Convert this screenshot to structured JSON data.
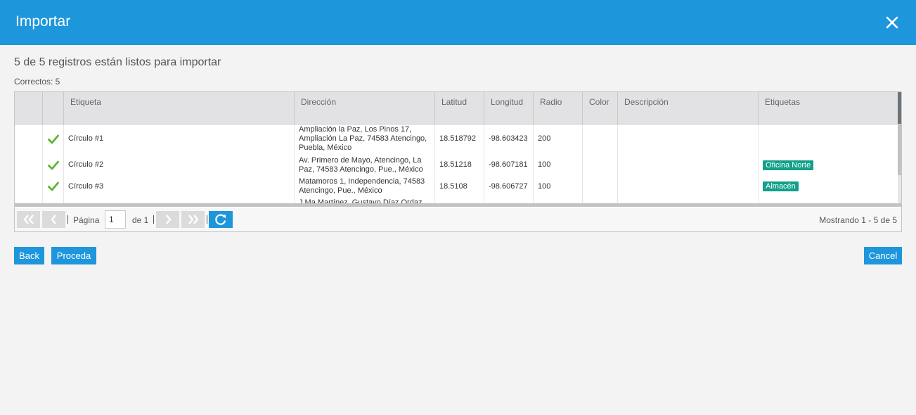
{
  "dialog": {
    "title": "Importar",
    "summary": "5 de 5 registros están listos para importar",
    "correct": "Correctos: 5"
  },
  "table": {
    "columns": [
      "Etiqueta",
      "Dirección",
      "Latitud",
      "Longitud",
      "Radio",
      "Color",
      "Descripción",
      "Etiquetas"
    ],
    "rows": [
      {
        "etiqueta": "Círculo #1",
        "direccion": "Ampliación la Paz, Los Pinos 17, Ampliación La Paz, 74583 Atencingo, Puebla, México",
        "latitud": "18.518792",
        "longitud": "-98.603423",
        "radio": "200",
        "color": "",
        "descripcion": "",
        "etiquetas": ""
      },
      {
        "etiqueta": "Círculo #2",
        "direccion": "Av. Primero de Mayo, Atencingo, La Paz, 74583 Atencingo, Pue., México",
        "latitud": "18.51218",
        "longitud": "-98.607181",
        "radio": "100",
        "color": "",
        "descripcion": "",
        "etiquetas": "Oficina Norte"
      },
      {
        "etiqueta": "Círculo #3",
        "direccion": "Matamoros 1, Independencia, 74583 Atencingo, Pue., México",
        "latitud": "18.5108",
        "longitud": "-98.606727",
        "radio": "100",
        "color": "",
        "descripcion": "",
        "etiquetas": "Almacén"
      },
      {
        "etiqueta": "",
        "direccion": "J Ma Martínez, Gustavo Díaz Ordaz",
        "latitud": "",
        "longitud": "",
        "radio": "",
        "color": "",
        "descripcion": "",
        "etiquetas": ""
      }
    ]
  },
  "pager": {
    "page_label": "Página",
    "page_value": "1",
    "of_label": "de 1",
    "showing": "Mostrando 1 - 5 de 5"
  },
  "buttons": {
    "back": "Back",
    "proceed": "Proceda",
    "cancel": "Cancel"
  },
  "icons": {
    "close": "close-icon",
    "check": "check-icon",
    "first": "first-page-icon",
    "prev": "prev-page-icon",
    "next": "next-page-icon",
    "last": "last-page-icon",
    "refresh": "refresh-icon"
  },
  "colors": {
    "primary": "#1d96dc",
    "check": "#5cb531",
    "tag": "#13a08a"
  }
}
